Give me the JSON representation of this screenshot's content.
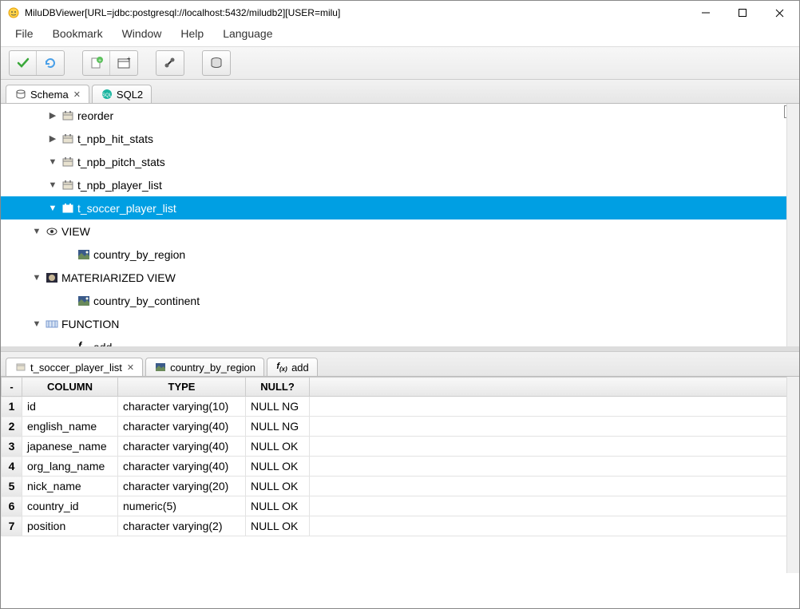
{
  "window": {
    "title": "MiluDBViewer[URL=jdbc:postgresql://localhost:5432/miludb2][USER=milu]"
  },
  "menubar": [
    "File",
    "Bookmark",
    "Window",
    "Help",
    "Language"
  ],
  "mainTabs": [
    {
      "label": "Schema",
      "icon": "db",
      "closable": true,
      "active": true
    },
    {
      "label": "SQL2",
      "icon": "sql",
      "closable": false,
      "active": false
    }
  ],
  "tree": {
    "counter": "1",
    "items": [
      {
        "indent": 58,
        "disclosure": "▶",
        "icon": "table",
        "label": "reorder",
        "selected": false
      },
      {
        "indent": 58,
        "disclosure": "▶",
        "icon": "table",
        "label": "t_npb_hit_stats",
        "selected": false
      },
      {
        "indent": 58,
        "disclosure": "▼",
        "icon": "table",
        "label": "t_npb_pitch_stats",
        "selected": false
      },
      {
        "indent": 58,
        "disclosure": "▼",
        "icon": "table",
        "label": "t_npb_player_list",
        "selected": false
      },
      {
        "indent": 58,
        "disclosure": "▼",
        "icon": "table-sel",
        "label": "t_soccer_player_list",
        "selected": true
      },
      {
        "indent": 38,
        "disclosure": "▼",
        "icon": "eye",
        "label": "VIEW",
        "selected": false
      },
      {
        "indent": 78,
        "disclosure": "",
        "icon": "img",
        "label": "country_by_region",
        "selected": false
      },
      {
        "indent": 38,
        "disclosure": "▼",
        "icon": "img2",
        "label": "MATERIARIZED VIEW",
        "selected": false
      },
      {
        "indent": 78,
        "disclosure": "",
        "icon": "img",
        "label": "country_by_continent",
        "selected": false
      },
      {
        "indent": 38,
        "disclosure": "▼",
        "icon": "func",
        "label": "FUNCTION",
        "selected": false
      },
      {
        "indent": 78,
        "disclosure": "",
        "icon": "fx",
        "label": "add",
        "selected": false
      }
    ]
  },
  "bottomTabs": [
    {
      "label": "t_soccer_player_list",
      "icon": "table",
      "closable": true,
      "active": true
    },
    {
      "label": "country_by_region",
      "icon": "img",
      "closable": false,
      "active": false
    },
    {
      "label": "add",
      "icon": "fx",
      "closable": false,
      "active": false
    }
  ],
  "table": {
    "headers": [
      "-",
      "COLUMN",
      "TYPE",
      "NULL?"
    ],
    "rows": [
      {
        "n": "1",
        "col": "id",
        "type": "character varying(10)",
        "null": "NULL NG"
      },
      {
        "n": "2",
        "col": "english_name",
        "type": "character varying(40)",
        "null": "NULL NG"
      },
      {
        "n": "3",
        "col": "japanese_name",
        "type": "character varying(40)",
        "null": "NULL OK"
      },
      {
        "n": "4",
        "col": "org_lang_name",
        "type": "character varying(40)",
        "null": "NULL OK"
      },
      {
        "n": "5",
        "col": "nick_name",
        "type": "character varying(20)",
        "null": "NULL OK"
      },
      {
        "n": "6",
        "col": "country_id",
        "type": "numeric(5)",
        "null": "NULL OK"
      },
      {
        "n": "7",
        "col": "position",
        "type": "character varying(2)",
        "null": "NULL OK"
      }
    ]
  }
}
